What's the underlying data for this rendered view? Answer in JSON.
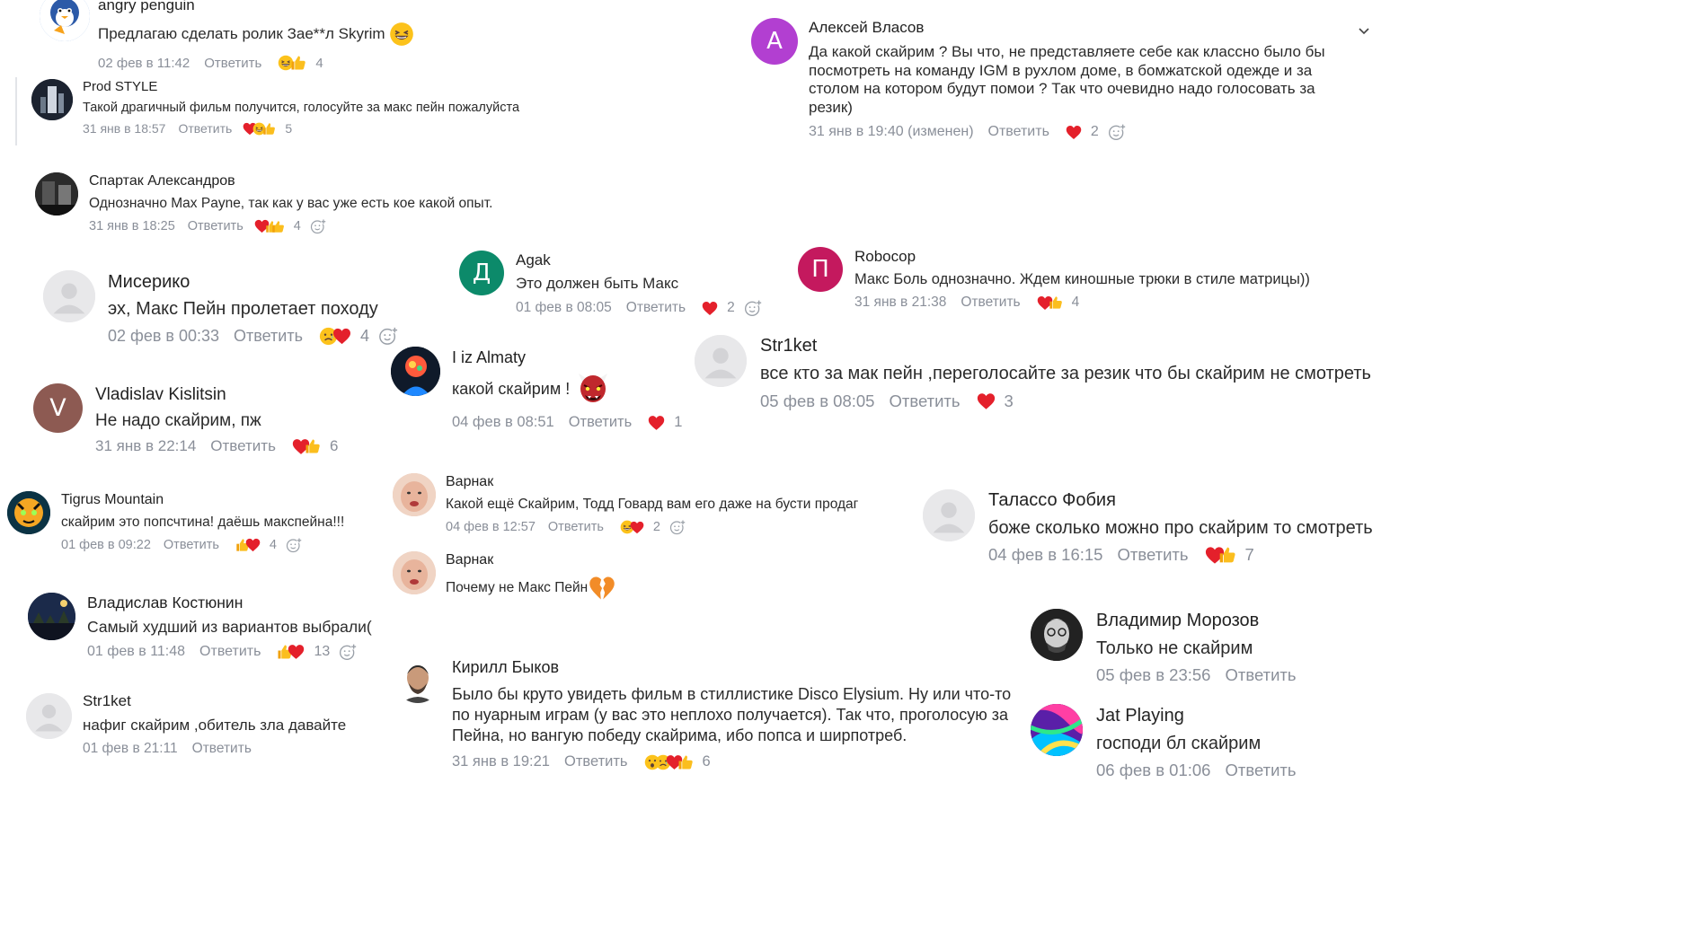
{
  "colors": {
    "meta_gray": "#8a8f99",
    "heart_red": "#e4202b",
    "avatar_purple": "#b23fd1",
    "avatar_green": "#0c8a6a",
    "avatar_magenta": "#c4195e",
    "avatar_brown": "#8d5a52"
  },
  "icons": [
    "heart-icon",
    "thumbs-up-icon",
    "laugh-emoji-icon",
    "grin-emoji-icon",
    "sad-emoji-icon",
    "surprised-emoji-icon",
    "broken-heart-icon",
    "ogre-emoji-icon",
    "add-reaction-icon",
    "collapse-chevron-icon"
  ],
  "reply_label": "Ответить",
  "comments": {
    "penguin": {
      "name": "angry penguin",
      "text": "Предлагаю сделать ролик Зае**л Skyrim",
      "time": "02 фев в 11:42",
      "count": "4"
    },
    "vlasov": {
      "initial": "А",
      "name": "Алексей Власов",
      "text": "Да какой скайрим ? Вы что, не представляете себе как классно было бы посмотреть на команду IGM в рухлом доме, в бомжатской одежде и за столом на котором будут помои ? Так что очевидно надо голосовать за резик)",
      "time": "31 янв в 19:40 (изменен)",
      "count": "2"
    },
    "prod": {
      "name": "Prod STYLE",
      "text": "Такой драгичный фильм получится, голосуйте за макс пейн пожалуйста",
      "time": "31 янв в 18:57",
      "count": "5"
    },
    "spartak": {
      "name": "Спартак Александров",
      "text": "Однозначно Max Payne, так как у вас уже есть кое какой опыт.",
      "time": "31 янв в 18:25",
      "count": "4"
    },
    "agak": {
      "initial": "Д",
      "name": "Agak",
      "text": "Это должен быть Макс",
      "time": "01 фев в 08:05",
      "count": "2"
    },
    "robocop": {
      "initial": "П",
      "name": "Robocop",
      "text": "Макс Боль однозначно. Ждем киношные трюки в стиле матрицы))",
      "time": "31 янв в 21:38",
      "count": "4"
    },
    "miseriko": {
      "name": "Мисерико",
      "text": "эх, Макс Пейн пролетает походу",
      "time": "02 фев в 00:33",
      "count": "4"
    },
    "almaty": {
      "name": "I iz Almaty",
      "text": "какой скайрим !",
      "time": "04 фев в 08:51",
      "count": "1"
    },
    "strket1": {
      "name": "Str1ket",
      "text": "все кто за мак пейн ,переголосайте за резик что бы скайрим не смотреть",
      "time": "05 фев в 08:05",
      "count": "3"
    },
    "vladislav": {
      "initial": "V",
      "name": "Vladislav Kislitsin",
      "text": "Не надо скайрим, пж",
      "time": "31 янв в 22:14",
      "count": "6"
    },
    "tigrus": {
      "name": "Tigrus Mountain",
      "text": "скайрим это попсчтина! даёшь макспейна!!!",
      "time": "01 фев в 09:22",
      "count": "4"
    },
    "varnak1": {
      "name": "Варнак",
      "text": "Какой ещё Скайрим, Тодд Говард вам его даже на бусти продаг",
      "time": "04 фев в 12:57",
      "count": "2"
    },
    "talasso": {
      "name": "Талассо Фобия",
      "text": "боже сколько можно про скайрим то смотреть",
      "time": "04 фев в 16:15",
      "count": "7"
    },
    "varnak2": {
      "name": "Варнак",
      "text": "Почему не Макс Пейн"
    },
    "kostyunin": {
      "name": "Владислав Костюнин",
      "text": "Самый худший из вариантов выбрали(",
      "time": "01 фев в 11:48",
      "count": "13"
    },
    "morozov": {
      "name": "Владимир Морозов",
      "text": "Только не скайрим",
      "time": "05 фев в 23:56"
    },
    "bykov": {
      "name": "Кирилл Быков",
      "text": "Было бы круто увидеть фильм в стиллистике Disco Elysium. Ну или что-то по нуарным играм (у вас это неплохо получается). Так что, проголосую за Пейна, но вангую победу скайрима, ибо попса и ширпотреб.",
      "time": "31 янв в 19:21",
      "count": "6"
    },
    "strket2": {
      "name": "Str1ket",
      "text": "нафиг скайрим ,обитель зла давайте",
      "time": "01 фев в 21:11"
    },
    "jat": {
      "name": "Jat Playing",
      "text": "господи бл скайрим",
      "time": "06 фев в 01:06"
    }
  }
}
